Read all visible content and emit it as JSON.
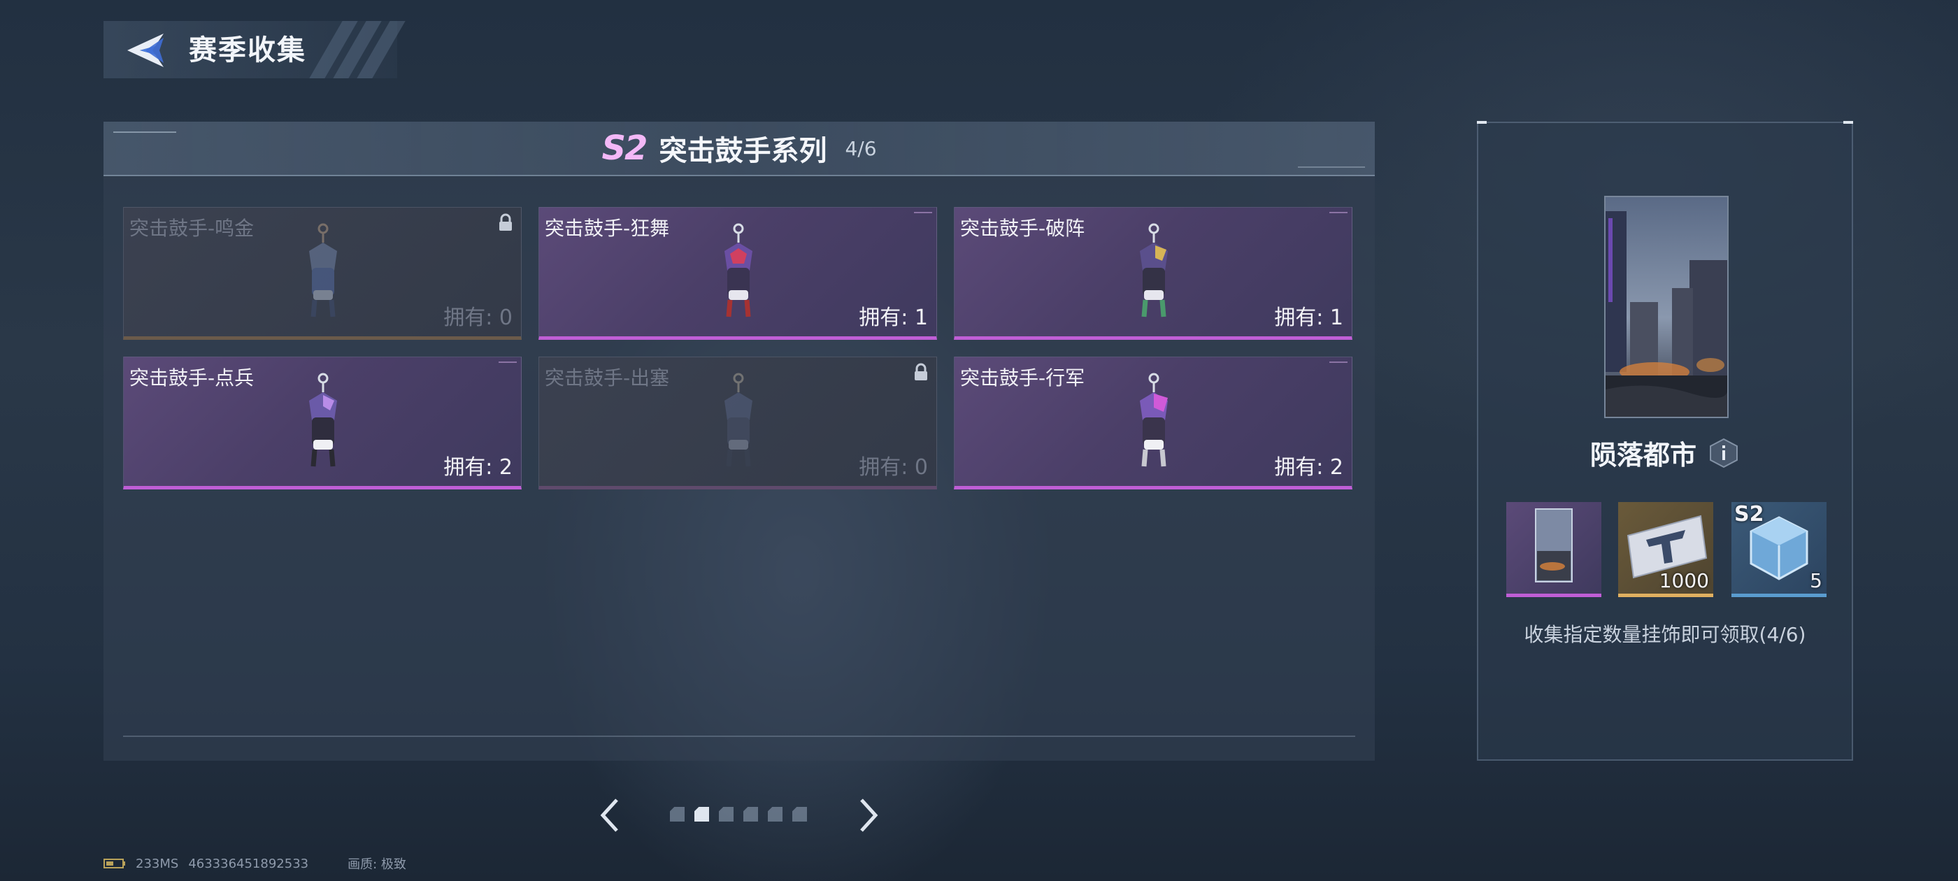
{
  "header": {
    "title": "赛季收集",
    "back_icon": "back-arrow-icon"
  },
  "series": {
    "logo": "S2",
    "name": "突击鼓手系列",
    "progress": "4/6"
  },
  "cards": [
    {
      "name": "突击鼓手-鸣金",
      "count": "拥有: 0",
      "owned": false
    },
    {
      "name": "突击鼓手-狂舞",
      "count": "拥有: 1",
      "owned": true
    },
    {
      "name": "突击鼓手-破阵",
      "count": "拥有: 1",
      "owned": true
    },
    {
      "name": "突击鼓手-点兵",
      "count": "拥有: 2",
      "owned": true
    },
    {
      "name": "突击鼓手-出塞",
      "count": "拥有: 0",
      "owned": false
    },
    {
      "name": "突击鼓手-行军",
      "count": "拥有: 2",
      "owned": true
    }
  ],
  "pagination": {
    "total_pages": 6,
    "current_page": 2
  },
  "reward": {
    "name": "陨落都市",
    "items": [
      {
        "qty": ""
      },
      {
        "qty": "1000"
      },
      {
        "tag": "S2",
        "qty": "5"
      }
    ],
    "hint": "收集指定数量挂饰即可领取(4/6)"
  },
  "footer": {
    "ping": "233MS",
    "uid": "463336451892533",
    "quality": "画质: 极致"
  },
  "colors": {
    "accent_purple": "#c05ed6",
    "accent_gold": "#e0b060",
    "accent_blue": "#5a9ccf",
    "logo_pink": "#f3b8f7"
  }
}
